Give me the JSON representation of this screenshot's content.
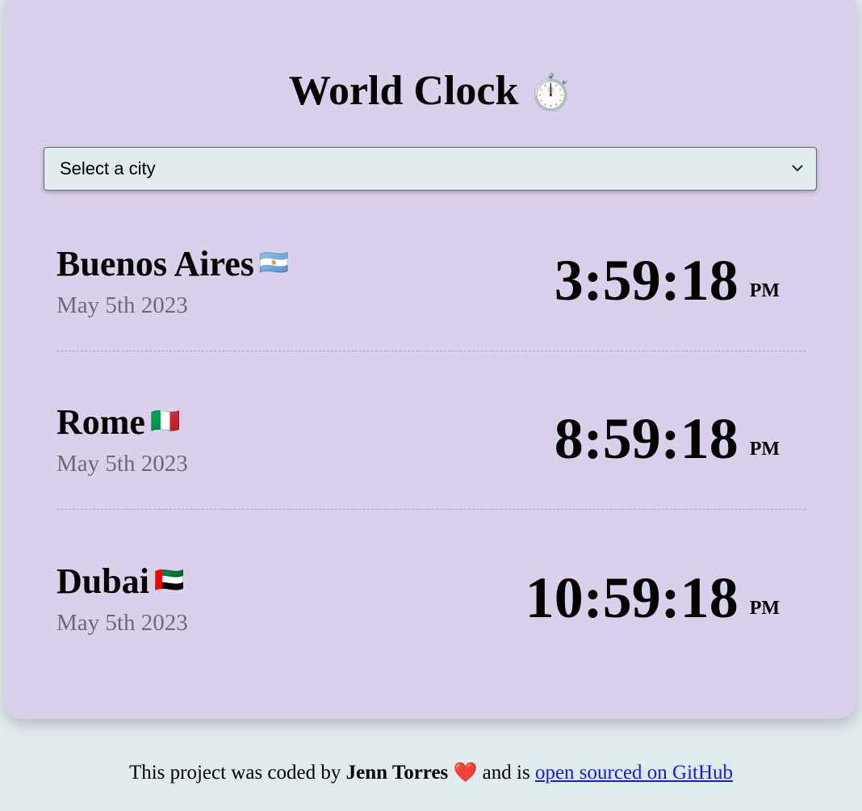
{
  "header": {
    "title": "World Clock",
    "title_emoji": "⏱️"
  },
  "city_select": {
    "selected": "Select a city"
  },
  "cities": [
    {
      "name": "Buenos Aires",
      "flag": "🇦🇷",
      "date": "May 5th 2023",
      "time": "3:59:18",
      "ampm": "PM"
    },
    {
      "name": "Rome",
      "flag": "🇮🇹",
      "date": "May 5th 2023",
      "time": "8:59:18",
      "ampm": "PM"
    },
    {
      "name": "Dubai",
      "flag": "🇦🇪",
      "date": "May 5th 2023",
      "time": "10:59:18",
      "ampm": "PM"
    }
  ],
  "footer": {
    "prefix": "This project was coded by",
    "author": "Jenn Torres",
    "heart": "❤️",
    "middle": "and is",
    "link_text": "open sourced on GitHub"
  },
  "icons": {
    "dropdown": "chevron-down-icon",
    "stopwatch": "stopwatch-icon",
    "heart": "heart-icon"
  },
  "colors": {
    "page_background": "#e0ebed",
    "card_background": "#dbd0eb",
    "date_text": "#6e6a73",
    "link": "#1a1ad8",
    "heart": "#d81f2a"
  }
}
